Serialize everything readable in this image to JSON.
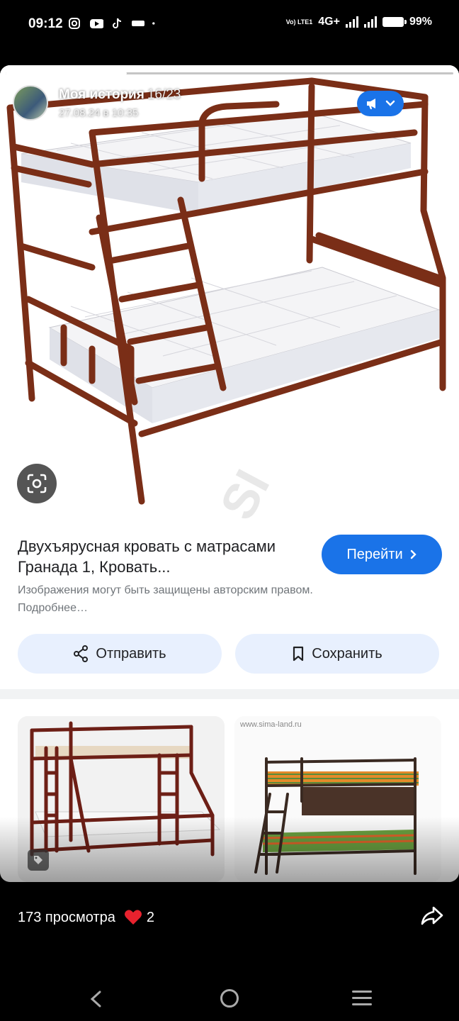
{
  "status_bar": {
    "time": "09:12",
    "left_icons": [
      "instagram-icon",
      "youtube-icon",
      "tiktok-icon",
      "app-icon",
      "dot-icon"
    ],
    "network": "4G+",
    "volte": "Vo) LTE1",
    "battery": "99%"
  },
  "story": {
    "progress_fraction": 0.27,
    "title": "Моя история",
    "counter": "16/23",
    "date": "27.08.24 в 10:35"
  },
  "result": {
    "title": "Двухъярусная кровать с матрасами Гранада 1, Кровать...",
    "go_label": "Перейти",
    "copyright_note": "Изображения могут быть защищены авторским правом. Подробнее…",
    "share_label": "Отправить",
    "save_label": "Сохранить",
    "watermark": "EGASI",
    "thumb2_caption": "www.sima-land.ru"
  },
  "footer": {
    "views": "173 просмотра",
    "likes": "2"
  },
  "colors": {
    "accent": "#1a73e8",
    "chip_bg": "#e8f0fe",
    "bed_frame": "#7a2e17",
    "heart": "#e8222e"
  }
}
